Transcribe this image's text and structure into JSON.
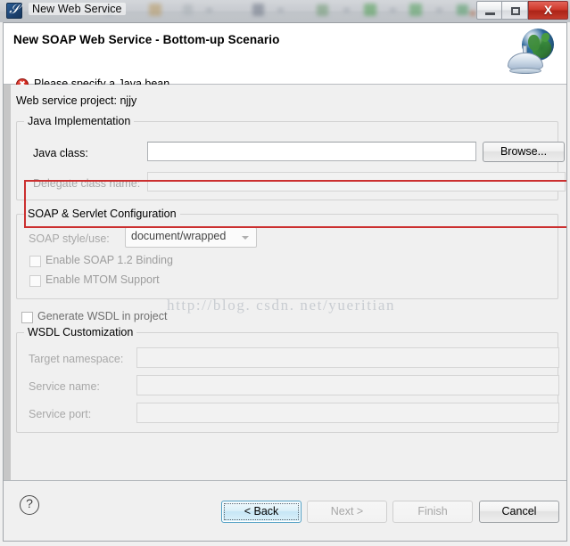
{
  "window": {
    "title": "New Web Service",
    "app_icon": "web-service-icon",
    "controls": {
      "minimize": "minimize-icon",
      "maximize": "maximize-icon",
      "close": "close-icon"
    }
  },
  "header": {
    "title": "New SOAP Web Service - Bottom-up Scenario",
    "message": "Please specify a Java bean",
    "message_icon": "error-icon",
    "banner_icon": "globe-satellite-dish-icon",
    "error_color": "#cc2118"
  },
  "content": {
    "project_line": "Web service project: njjy",
    "java_implementation": {
      "legend": "Java Implementation",
      "java_class_label": "Java class:",
      "java_class_value": "",
      "java_class_placeholder": "",
      "browse_label": "Browse...",
      "delegate_label": "Delegate class name:",
      "delegate_value": ""
    },
    "soap_servlet": {
      "legend": "SOAP & Servlet Configuration",
      "style_label": "SOAP style/use:",
      "style_value": "document/wrapped",
      "style_options": [
        "document/wrapped"
      ],
      "checkboxes": [
        {
          "label": "Enable SOAP 1.2 Binding",
          "checked": false
        },
        {
          "label": "Enable MTOM Support",
          "checked": false
        }
      ]
    },
    "generate_wsdl": {
      "label": "Generate WSDL in project",
      "checked": false
    },
    "wsdl_customization": {
      "legend": "WSDL Customization",
      "fields": [
        {
          "label": "Target namespace:",
          "value": ""
        },
        {
          "label": "Service name:",
          "value": ""
        },
        {
          "label": "Service port:",
          "value": ""
        }
      ]
    }
  },
  "annotation": {
    "watermark": "http://blog. csdn. net/yueritian",
    "highlight_color": "#cb2f2f"
  },
  "footer": {
    "help": "?",
    "back": "< Back",
    "next": "Next >",
    "finish": "Finish",
    "cancel": "Cancel"
  }
}
